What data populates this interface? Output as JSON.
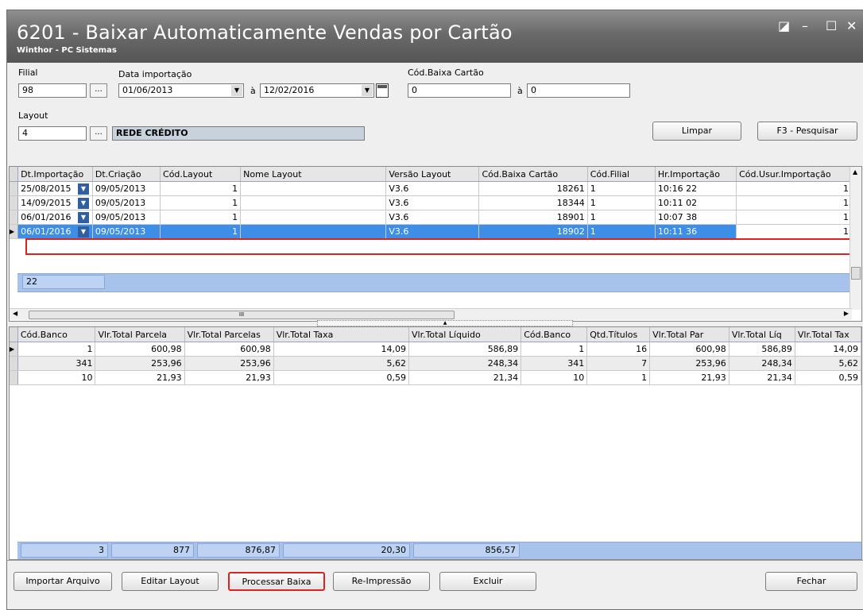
{
  "window": {
    "title": "6201 - Baixar Automaticamente Vendas por Cartão",
    "subtitle": "Winthor - PC Sistemas",
    "controls": {
      "restore": "◪",
      "minimize": "–",
      "maximize": "☐",
      "close": "✕"
    }
  },
  "filters": {
    "filial_label": "Filial",
    "filial_value": "98",
    "data_label": "Data importação",
    "data_from": "01/06/2013",
    "data_to": "12/02/2016",
    "to_sep": "à",
    "cod_baixa_label": "Cód.Baixa Cartão",
    "cod_baixa_from": "0",
    "cod_baixa_to": "0",
    "layout_label": "Layout",
    "layout_value": "4",
    "layout_name": "REDE CRÉDITO",
    "dots": "...",
    "dropdown_arrow": "▼"
  },
  "buttons": {
    "limpar": "Limpar",
    "pesquisar": "F3 - Pesquisar",
    "importar": "Importar Arquivo",
    "editar": "Editar Layout",
    "processar": "Processar Baixa",
    "reimpressao": "Re-Impressão",
    "excluir": "Excluir",
    "fechar": "Fechar"
  },
  "top_grid": {
    "columns": [
      "Dt.Importação",
      "Dt.Criação",
      "Cód.Layout",
      "Nome Layout",
      "Versão Layout",
      "Cód.Baixa Cartão",
      "Cód.Filial",
      "Hr.Importação",
      "Cód.Usur.Importação"
    ],
    "rows": [
      [
        "25/08/2015",
        "09/05/2013",
        "1",
        "",
        "V3.6",
        "18261",
        "1",
        "10:16 22",
        "1"
      ],
      [
        "14/09/2015",
        "09/05/2013",
        "1",
        "",
        "V3.6",
        "18344",
        "1",
        "10:11 02",
        "1"
      ],
      [
        "06/01/2016",
        "09/05/2013",
        "1",
        "",
        "V3.6",
        "18901",
        "1",
        "10:07 38",
        "1"
      ],
      [
        "06/01/2016",
        "09/05/2013",
        "1",
        "",
        "V3.6",
        "18902",
        "1",
        "10:11 36",
        "1"
      ]
    ],
    "selected_row": 3,
    "count": "22",
    "scroll_grip": "III"
  },
  "bottom_grid": {
    "columns": [
      "Cód.Banco",
      "Vlr.Total Parcela",
      "Vlr.Total Parcelas",
      "Vlr.Total Taxa",
      "Vlr.Total Líquido",
      "Cód.Banco",
      "Qtd.Títulos",
      "Vlr.Total Par",
      "Vlr.Total Líq",
      "Vlr.Total Tax"
    ],
    "rows": [
      [
        "1",
        "600,98",
        "600,98",
        "14,09",
        "586,89",
        "1",
        "16",
        "600,98",
        "586,89",
        "14,09"
      ],
      [
        "341",
        "253,96",
        "253,96",
        "5,62",
        "248,34",
        "341",
        "7",
        "253,96",
        "248,34",
        "5,62"
      ],
      [
        "10",
        "21,93",
        "21,93",
        "0,59",
        "21,34",
        "10",
        "1",
        "21,93",
        "21,34",
        "0,59"
      ]
    ],
    "totals": [
      "3",
      "877",
      "876,87",
      "20,30",
      "856,57"
    ]
  }
}
